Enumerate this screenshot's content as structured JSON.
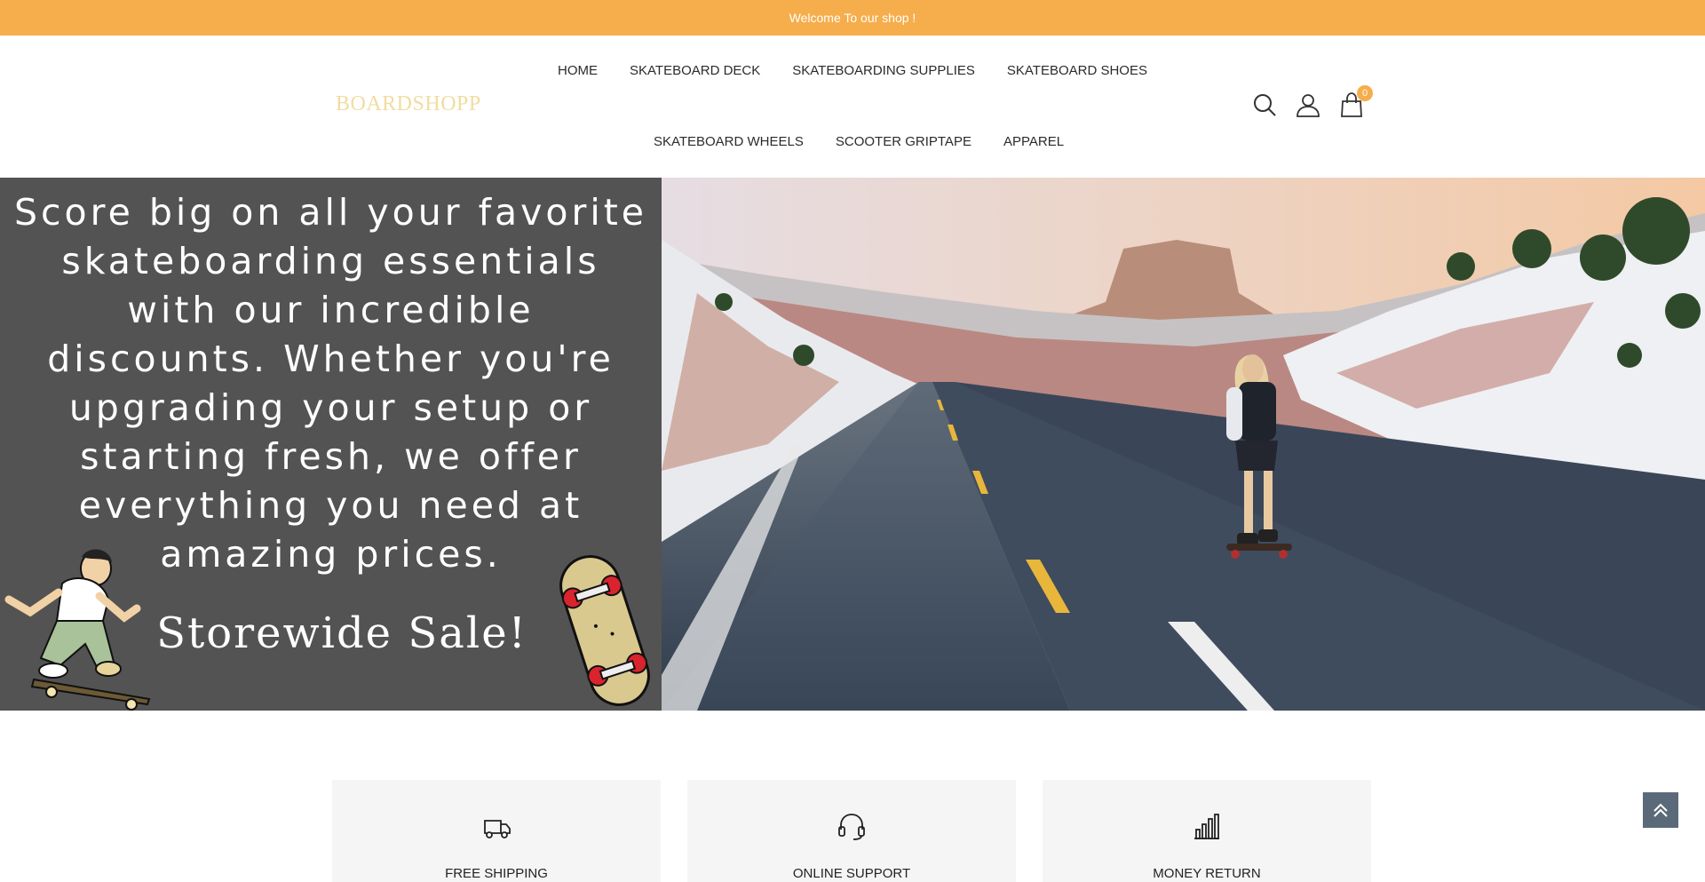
{
  "topbar": {
    "text": "Welcome To our shop !"
  },
  "header": {
    "logo": "BOARDSHOPP",
    "nav_row1": [
      "HOME",
      "SKATEBOARD DECK",
      "SKATEBOARDING SUPPLIES",
      "SKATEBOARD SHOES"
    ],
    "nav_row2": [
      "SKATEBOARD WHEELS",
      "SCOOTER GRIPTAPE",
      "APPAREL"
    ],
    "icons": [
      "search-icon",
      "user-icon",
      "cart-icon"
    ],
    "cart_count": "0"
  },
  "hero": {
    "text": "Score big on all your favorite skateboarding essentials with our incredible discounts. Whether you're upgrading your setup or starting fresh, we offer everything you need at amazing prices.",
    "sale": "Storewide Sale!"
  },
  "features": [
    {
      "icon": "truck-icon",
      "title": "FREE SHIPPING"
    },
    {
      "icon": "headset-icon",
      "title": "ONLINE SUPPORT"
    },
    {
      "icon": "bar-chart-icon",
      "title": "MONEY RETURN"
    }
  ],
  "colors": {
    "accent": "#f6ad4b",
    "hero_panel": "#535353",
    "scroll_top": "#5b6a78"
  }
}
